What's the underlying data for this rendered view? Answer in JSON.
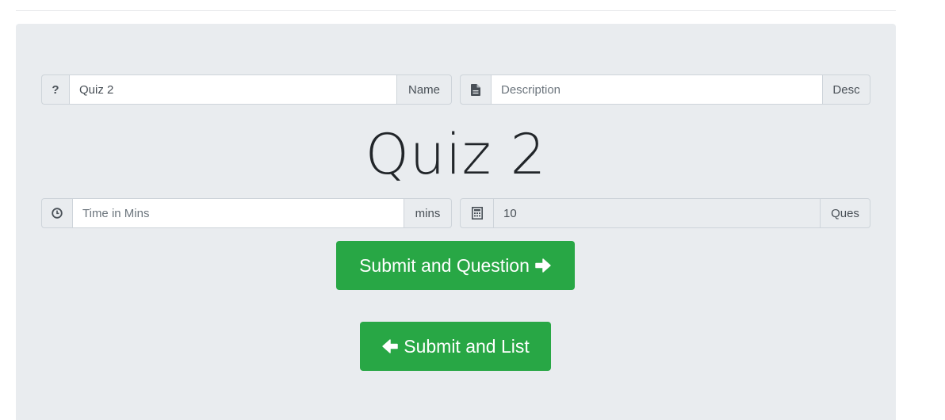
{
  "quiz_name": {
    "icon": "question-icon",
    "value": "Quiz 2",
    "append_label": "Name"
  },
  "description": {
    "icon": "file-icon",
    "placeholder": "Description",
    "append_label": "Desc"
  },
  "title": "Quiz 2",
  "time": {
    "icon": "clock-icon",
    "placeholder": "Time in Mins",
    "append_label": "mins"
  },
  "questions": {
    "icon": "calculator-icon",
    "value": "10",
    "append_label": "Ques"
  },
  "buttons": {
    "submit_question": "Submit and Question",
    "submit_question_icon": "arrow-right-icon",
    "submit_list": "Submit and List",
    "submit_list_icon": "arrow-left-icon",
    "color": "#28a745"
  }
}
